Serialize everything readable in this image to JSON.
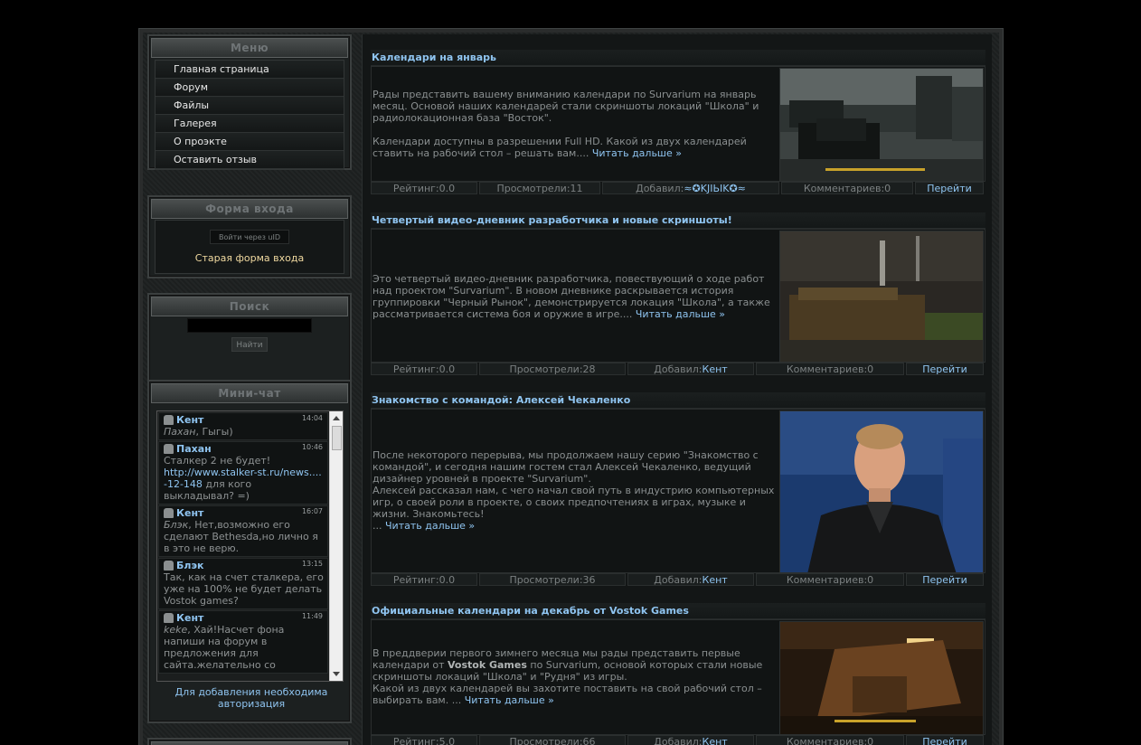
{
  "menu": {
    "title": "Меню",
    "items": [
      {
        "label": "Главная страница"
      },
      {
        "label": "Форум"
      },
      {
        "label": "Файлы"
      },
      {
        "label": "Галерея"
      },
      {
        "label": "О проэкте"
      },
      {
        "label": "Оставить отзыв"
      }
    ]
  },
  "login": {
    "title": "Форма входа",
    "uid_button": "Войти через uID",
    "old_form_link": "Старая форма входа"
  },
  "search": {
    "title": "Поиск",
    "input_value": "",
    "button": "Найти"
  },
  "chat": {
    "title": "Мини-чат",
    "messages": [
      {
        "user": "Кент",
        "time": "14:04",
        "quote": "Пахан",
        "text": ", Гыгы)"
      },
      {
        "user": "Пахан",
        "time": "10:46",
        "text": "Сталкер 2 не будет!",
        "link": "http://www.stalker-st.ru/news....-12-148",
        "text_after": " для кого выкладывал? =)"
      },
      {
        "user": "Кент",
        "time": "16:07",
        "quote": "Блэк",
        "text": ", Нет,возможно его сделают Bethesda,но лично я в это не верю."
      },
      {
        "user": "Блэк",
        "time": "13:15",
        "text": "Так, как на счет сталкера, его уже на 100% не будет делать Vostok games?"
      },
      {
        "user": "Кент",
        "time": "11:49",
        "quote": "keke",
        "text": ", Хай!Насчет фона напиши на форум в предложения для сайта.желательно со"
      }
    ],
    "note": "Для добавления необходима авторизация"
  },
  "posts": [
    {
      "title": "Календари на январь",
      "paragraphs": [
        "Рады представить вашему вниманию календари по Survarium на январь месяц. Основой наших календарей стали скриншоты локаций \"Школа\" и радиолокационная база \"Восток\".",
        "Календари доступны в разрешении Full HD. Какой из двух календарей ставить на рабочий стол – решать вам.... "
      ],
      "more": "Читать дальше »",
      "rating": "Рейтинг:0.0",
      "views": "Просмотрели:11",
      "added_label": "Добавил:",
      "author": "≈✪KJIЬIK✪≈",
      "comments": "Комментариев:0",
      "goto": "Перейти"
    },
    {
      "title": "Четвертый видео-дневник разработчика и новые скриншоты!",
      "paragraphs": [
        "Это четвертый видео-дневник разработчика, повествующий о ходе работ над проектом \"Survarium\". В новом дневнике раскрывается история группировки \"Черный Рынок\", демонстрируется локация \"Школа\", а также рассматривается система боя и оружие в игре.... "
      ],
      "more": "Читать дальше »",
      "rating": "Рейтинг:0.0",
      "views": "Просмотрели:28",
      "added_label": "Добавил:",
      "author": "Кент",
      "comments": "Комментариев:0",
      "goto": "Перейти"
    },
    {
      "title": "Знакомство с командой: Алексей Чекаленко",
      "paragraphs": [
        "После некоторого перерыва, мы продолжаем нашу серию \"Знакомство с командой\", и сегодня нашим гостем стал Алексей Чекаленко, ведущий дизайнер уровней в проекте \"Survarium\".",
        "Алексей рассказал нам, с чего начал свой путь в индустрию компьютерных игр, о своей роли в проекте, о своих предпочтениях в играх, музыке и жизни. Знакомьтесь!",
        "... "
      ],
      "more": "Читать дальше »",
      "rating": "Рейтинг:0.0",
      "views": "Просмотрели:36",
      "added_label": "Добавил:",
      "author": "Кент",
      "comments": "Комментариев:0",
      "goto": "Перейти"
    },
    {
      "title": "Официальные календари на декабрь от Vostok Games",
      "p1_before": "В преддверии первого зимнего месяца мы рады представить первые календари от ",
      "p1_bold": "Vostok Games",
      "p1_after": " по Survarium, основой которых стали новые скриншоты локаций \"Школа\" и \"Рудня\" из игры.",
      "p2": "Какой из двух календарей вы захотите поставить на свой рабочий стол – выбирать вам. ... ",
      "more": "Читать дальше »",
      "rating": "Рейтинг:5.0",
      "views": "Просмотрели:66",
      "added_label": "Добавил:",
      "author": "Кент",
      "comments": "Комментариев:0",
      "goto": "Перейти"
    }
  ],
  "colors": {
    "link": "#8fc4f0",
    "text": "#8a8f90",
    "background": "#000000",
    "accent_login": "#f0d9a0"
  }
}
